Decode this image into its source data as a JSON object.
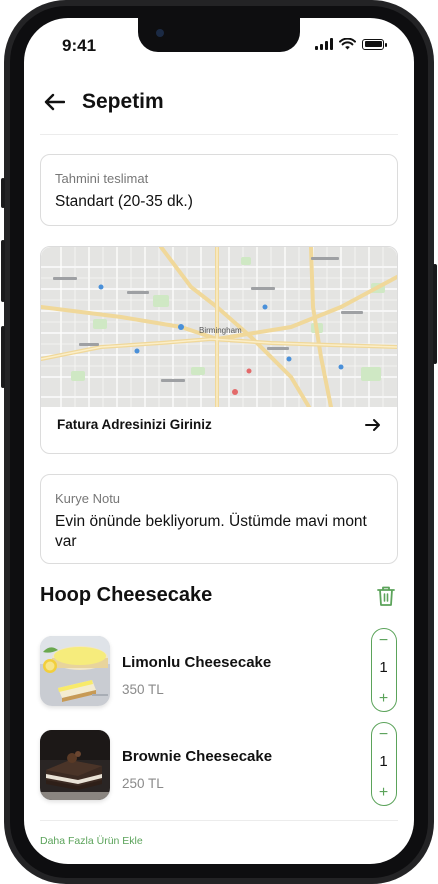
{
  "status_bar": {
    "time": "9:41"
  },
  "header": {
    "title": "Sepetim"
  },
  "delivery": {
    "label": "Tahmini teslimat",
    "value": "Standart (20-35 dk.)"
  },
  "map_card": {
    "label": "Fatura Adresinizi Giriniz",
    "map_text": [
      "Birmingham"
    ]
  },
  "courier_note": {
    "label": "Kurye Notu",
    "value": "Evin önünde bekliyorum. Üstümde mavi mont var"
  },
  "store": {
    "name": "Hoop Cheesecake"
  },
  "items": [
    {
      "name": "Limonlu Cheesecake",
      "price": "350 TL",
      "quantity": "1"
    },
    {
      "name": "Brownie Cheesecake",
      "price": "250 TL",
      "quantity": "1"
    }
  ],
  "stepper": {
    "minus": "−",
    "plus": "+"
  },
  "footer": {
    "add_more": "Daha Fazla Ürün Ekle"
  },
  "colors": {
    "accent": "#5ba35a",
    "text": "#111111",
    "muted": "#8a8a8a",
    "border": "#dcdcdc"
  }
}
